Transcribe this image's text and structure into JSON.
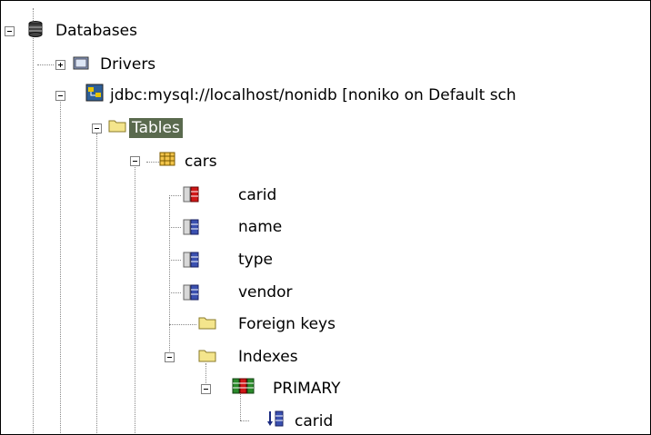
{
  "tree": {
    "databases": {
      "label": "Databases",
      "icon": "database-icon"
    },
    "drivers": {
      "label": "Drivers",
      "icon": "drivers-folder-icon"
    },
    "connection": {
      "label": "jdbc:mysql://localhost/nonidb [noniko on Default sch",
      "icon": "connection-icon"
    },
    "tables": {
      "label": "Tables",
      "icon": "folder-icon",
      "selected": true
    },
    "cars": {
      "label": "cars",
      "icon": "table-icon"
    },
    "columns": [
      {
        "label": "carid",
        "icon": "primary-key-column-icon"
      },
      {
        "label": "name",
        "icon": "column-icon"
      },
      {
        "label": "type",
        "icon": "column-icon"
      },
      {
        "label": "vendor",
        "icon": "column-icon"
      }
    ],
    "foreign_keys": {
      "label": "Foreign keys",
      "icon": "folder-icon"
    },
    "indexes": {
      "label": "Indexes",
      "icon": "folder-icon"
    },
    "primary": {
      "label": "PRIMARY",
      "icon": "index-icon"
    },
    "index_column": {
      "label": "carid",
      "icon": "index-column-icon"
    }
  },
  "colors": {
    "selection": "#5a6a4e",
    "folder": "#f4e58c",
    "pk_column": "#d01818",
    "column": "#3a50b0"
  }
}
